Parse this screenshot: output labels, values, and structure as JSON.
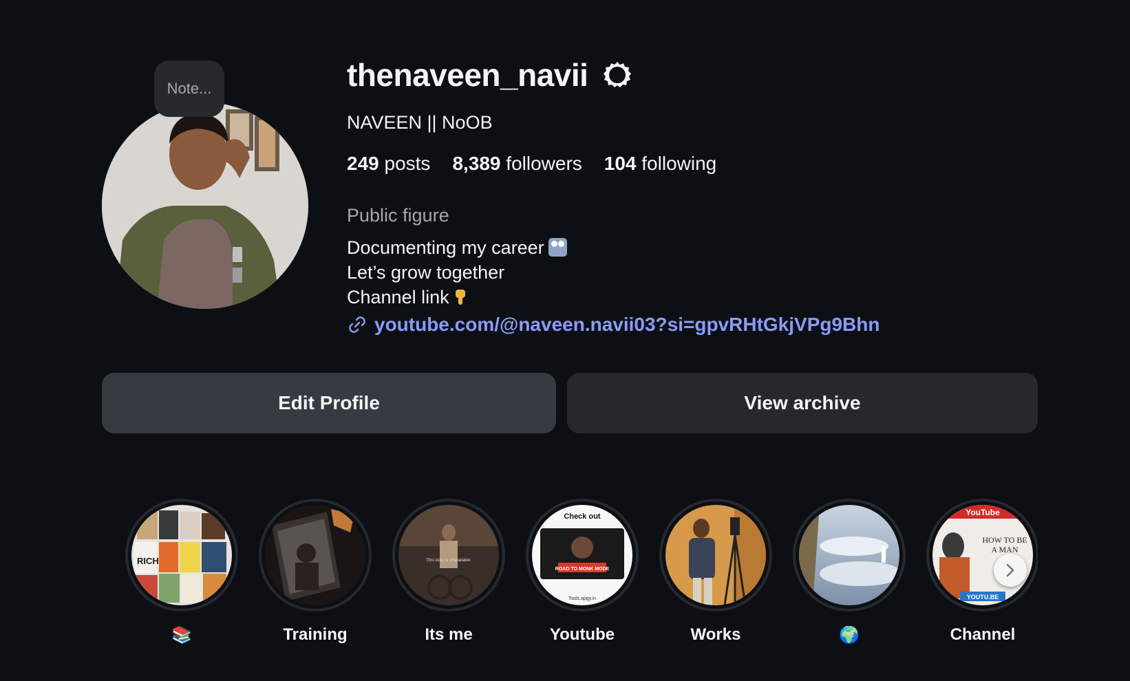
{
  "profile": {
    "username": "thenaveen_navii",
    "note_placeholder": "Note...",
    "full_name": "NAVEEN || NoOB",
    "stats": {
      "posts_count": "249",
      "posts_label": "posts",
      "followers_count": "8,389",
      "followers_label": "followers",
      "following_count": "104",
      "following_label": "following"
    },
    "category": "Public figure",
    "bio": {
      "line1": "Documenting my career",
      "line1_emoji": "movie-camera-icon",
      "line2": "Let’s grow together",
      "line3": "Channel link",
      "line3_emoji": "pointing-down-icon"
    },
    "link": "youtube.com/@naveen.navii03?si=gpvRHtGkjVPg9Bhn"
  },
  "actions": {
    "edit_profile": "Edit Profile",
    "view_archive": "View archive"
  },
  "highlights": [
    {
      "label": "📚",
      "cover": "books-collage"
    },
    {
      "label": "Training",
      "cover": "dark-training-photo"
    },
    {
      "label": "Its me",
      "cover": "unavailable-story"
    },
    {
      "label": "Youtube",
      "cover": "check-out-road-to-monk-mode"
    },
    {
      "label": "Works",
      "cover": "person-with-tripod"
    },
    {
      "label": "🌍",
      "cover": "cloudy-landscape"
    },
    {
      "label": "Channel",
      "cover": "youtube-how-to-be-a-man"
    }
  ],
  "highlight_cover_texts": {
    "its_me": "This story is unavailable.",
    "youtube_top": "Check out",
    "youtube_banner": "ROAD TO MONK MODE",
    "youtube_footer": "Tools.apgy.in",
    "channel_top": "YouTube",
    "channel_title": "HOW TO BE A MAN",
    "channel_footer": "YOUTU.BE",
    "books_spine": "RICH"
  },
  "colors": {
    "background": "#0c1014",
    "link": "#8c9bf7",
    "secondary_text": "#a8a8a8",
    "edit_button": "#363a41",
    "archive_button": "#25292e"
  }
}
